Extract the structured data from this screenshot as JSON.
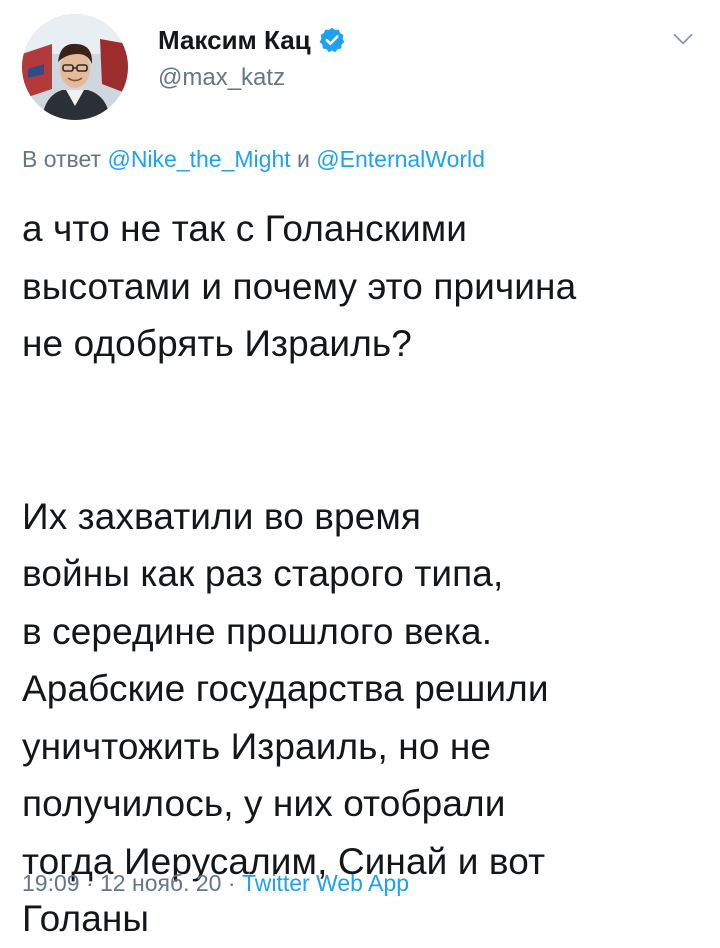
{
  "author": {
    "display_name": "Максим Кац",
    "handle": "@max_katz",
    "verified_icon": "verified-badge-icon"
  },
  "reply": {
    "prefix": "В ответ",
    "mention1": "@Nike_the_Might",
    "conjunction": "и",
    "mention2": "@EnternalWorld"
  },
  "text": {
    "paragraph1": [
      "а что не так с Голанскими",
      "высотами и почему это причина",
      "не одобрять Израиль?"
    ],
    "paragraph2": [
      "Их захватили во время",
      "войны как раз старого типа,",
      "в середине прошлого века.",
      "Арабские государства решили",
      "уничтожить Израиль, но не",
      "получилось, у них отобрали",
      "тогда Иерусалим, Синай и вот",
      "Голаны"
    ]
  },
  "meta": {
    "time": "19:09",
    "separator": "·",
    "date": "12 нояб. 20",
    "source": "Twitter Web App"
  },
  "colors": {
    "accent": "#1da1f2",
    "secondary_text": "#657786",
    "primary_text": "#14171a"
  }
}
